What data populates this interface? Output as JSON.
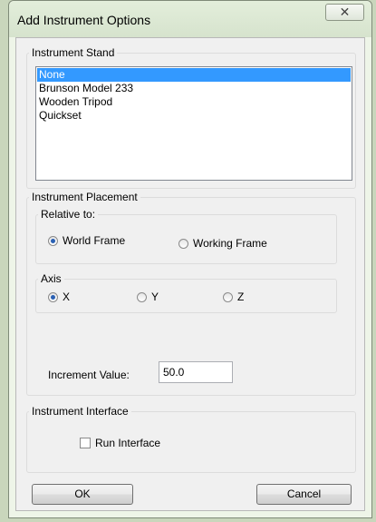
{
  "dialog": {
    "title": "Add Instrument Options",
    "close_glyph": "✕"
  },
  "instrument_stand": {
    "legend": "Instrument Stand",
    "items": [
      {
        "label": "None",
        "selected": true
      },
      {
        "label": "Brunson Model 233",
        "selected": false
      },
      {
        "label": "Wooden Tripod",
        "selected": false
      },
      {
        "label": "Quickset",
        "selected": false
      }
    ]
  },
  "instrument_placement": {
    "legend": "Instrument Placement",
    "relative_to": {
      "legend": "Relative to:",
      "options": [
        {
          "label": "World Frame",
          "checked": true
        },
        {
          "label": "Working Frame",
          "checked": false
        }
      ]
    },
    "axis": {
      "legend": "Axis",
      "options": [
        {
          "label": "X",
          "checked": true
        },
        {
          "label": "Y",
          "checked": false
        },
        {
          "label": "Z",
          "checked": false
        }
      ]
    },
    "increment": {
      "label": "Increment Value:",
      "value": "50.0"
    }
  },
  "instrument_interface": {
    "legend": "Instrument Interface",
    "run_interface": {
      "label": "Run Interface",
      "checked": false
    }
  },
  "buttons": {
    "ok_label": "OK",
    "cancel_label": "Cancel"
  },
  "colors": {
    "selection": "#3399ff",
    "radio_dot": "#2a60b3"
  }
}
